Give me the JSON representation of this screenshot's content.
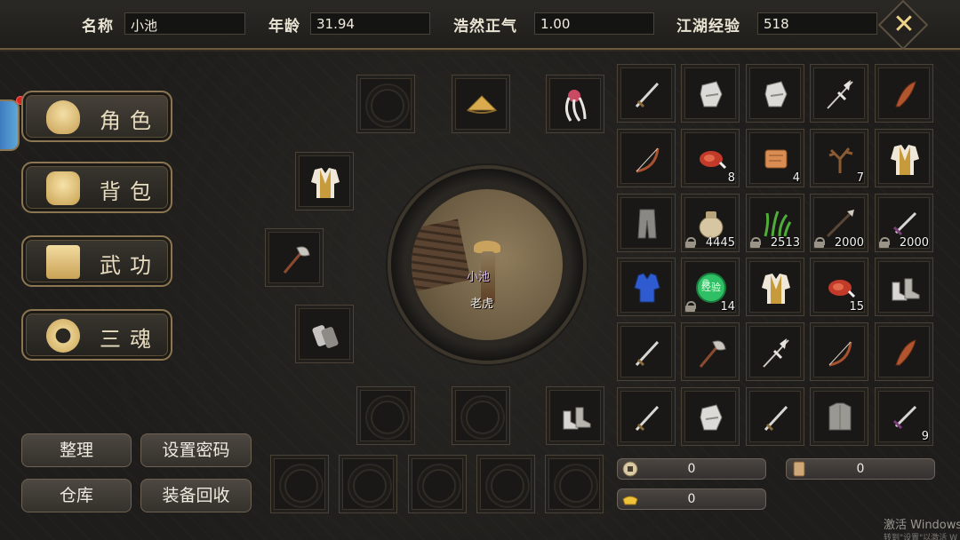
{
  "header": {
    "name_label": "名称",
    "name_value": "小池",
    "age_label": "年龄",
    "age_value": "31.94",
    "righteousness_label": "浩然正气",
    "righteousness_value": "1.00",
    "experience_label": "江湖经验",
    "experience_value": "518",
    "close_icon": "close-icon",
    "accent_color": "#f0d38a"
  },
  "menu": [
    {
      "label": "角色",
      "icon": "character-icon"
    },
    {
      "label": "背包",
      "icon": "backpack-icon"
    },
    {
      "label": "武功",
      "icon": "martial-arts-scroll-icon"
    },
    {
      "label": "三魂",
      "icon": "three-souls-icon"
    }
  ],
  "actions": {
    "sort": "整理",
    "set_password": "设置密码",
    "warehouse": "仓库",
    "recycle": "装备回收"
  },
  "portrait": {
    "character_name": "小池",
    "mount_name": "老虎"
  },
  "equipment": {
    "hat": "straw-hat-icon",
    "hair": "white-hair-icon",
    "armor": "robe-icon",
    "weapon": "axe-icon",
    "gloves": "bracer-icon",
    "boots": "boots-icon"
  },
  "inventory": [
    {
      "icon": "sword-icon",
      "qty": ""
    },
    {
      "icon": "gauntlet-icon",
      "qty": ""
    },
    {
      "icon": "gauntlet-icon",
      "qty": ""
    },
    {
      "icon": "halberd-icon",
      "qty": ""
    },
    {
      "icon": "feather-icon",
      "qty": ""
    },
    {
      "icon": "bow-icon",
      "qty": ""
    },
    {
      "icon": "meat-icon",
      "qty": "8"
    },
    {
      "icon": "scroll-icon",
      "qty": "4"
    },
    {
      "icon": "antler-icon",
      "qty": "7"
    },
    {
      "icon": "robe-icon",
      "qty": ""
    },
    {
      "icon": "trousers-icon",
      "qty": ""
    },
    {
      "icon": "sack-icon",
      "qty": "4445",
      "locked": true
    },
    {
      "icon": "herb-icon",
      "qty": "2513",
      "locked": true
    },
    {
      "icon": "spear-icon",
      "qty": "2000",
      "locked": true
    },
    {
      "icon": "dagger-icon",
      "qty": "2000",
      "locked": true
    },
    {
      "icon": "blue-vest-icon",
      "qty": ""
    },
    {
      "icon": "exp-orb-icon",
      "qty": "14",
      "locked": true,
      "text": "经验"
    },
    {
      "icon": "robe-icon",
      "qty": ""
    },
    {
      "icon": "meat-icon",
      "qty": "15"
    },
    {
      "icon": "boots-icon",
      "qty": ""
    },
    {
      "icon": "sword-icon",
      "qty": ""
    },
    {
      "icon": "axe-icon",
      "qty": ""
    },
    {
      "icon": "halberd-icon",
      "qty": ""
    },
    {
      "icon": "bow-icon",
      "qty": ""
    },
    {
      "icon": "feather-icon",
      "qty": ""
    },
    {
      "icon": "sword-icon",
      "qty": ""
    },
    {
      "icon": "gauntlet-icon",
      "qty": ""
    },
    {
      "icon": "sword-icon",
      "qty": ""
    },
    {
      "icon": "chestplate-icon",
      "qty": ""
    },
    {
      "icon": "dagger-icon",
      "qty": "9"
    }
  ],
  "currency": {
    "copper": "0",
    "token": "0",
    "gold": "0"
  },
  "watermark": {
    "line1": "激活 Windows",
    "line2": "转到\"设置\"以激活 W"
  }
}
